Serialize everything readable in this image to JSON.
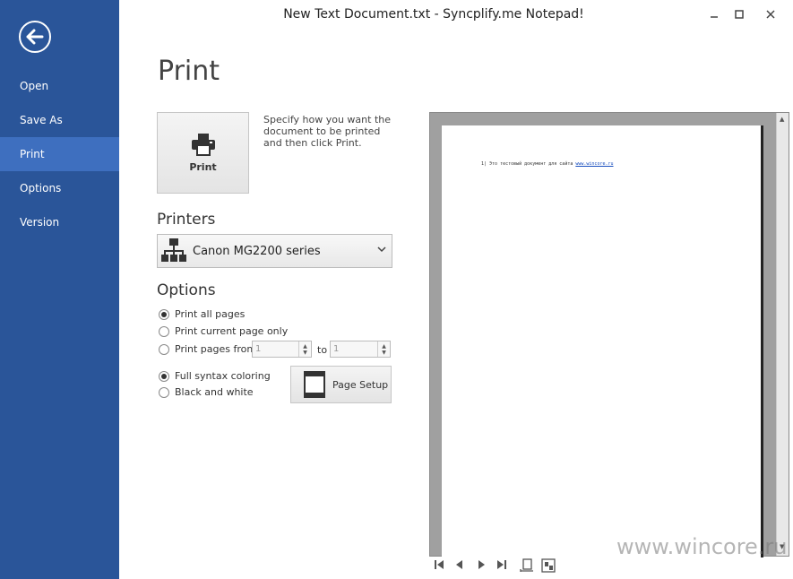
{
  "window": {
    "title": "New Text Document.txt - Syncplify.me Notepad!"
  },
  "sidebar": {
    "items": [
      {
        "label": "Open"
      },
      {
        "label": "Save As"
      },
      {
        "label": "Print"
      },
      {
        "label": "Options"
      },
      {
        "label": "Version"
      }
    ],
    "active": "Print"
  },
  "main": {
    "heading": "Print",
    "print_button_label": "Print",
    "description": "Specify how you want the document to be printed and then click Print.",
    "printers_heading": "Printers",
    "selected_printer": "Canon MG2200 series",
    "options_heading": "Options",
    "page_options": [
      {
        "label": "Print all pages",
        "checked": true
      },
      {
        "label": "Print current page only",
        "checked": false
      },
      {
        "label": "Print pages from",
        "checked": false
      }
    ],
    "from_value": "1",
    "to_label": "to",
    "to_value": "1",
    "color_options": [
      {
        "label": "Full syntax coloring",
        "checked": true
      },
      {
        "label": "Black and white",
        "checked": false
      }
    ],
    "page_setup_label": "Page Setup"
  },
  "preview": {
    "line_text": "1| Это тестовый документ для сайта ",
    "link_text": "www.wincore.ru"
  },
  "watermark": "www.wincore.ru",
  "colors": {
    "sidebar": "#2a5599",
    "sidebar_active": "#3e6fbf"
  }
}
